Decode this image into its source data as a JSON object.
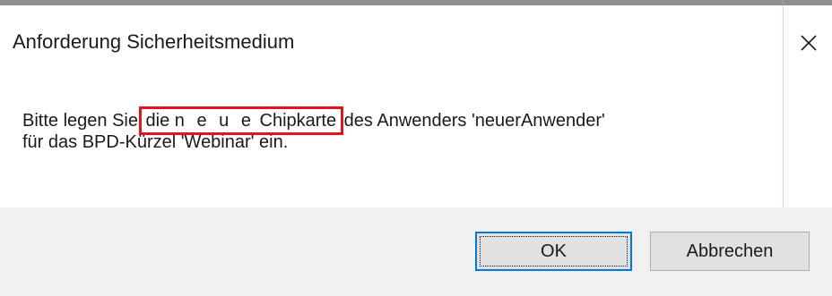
{
  "dialog": {
    "title": "Anforderung Sicherheitsmedium",
    "close_icon": "close-icon",
    "message": {
      "before": "Bitte legen Sie ",
      "highlight_1": "die ",
      "highlight_2": "n e u e",
      "highlight_3": " Chipkarte",
      "after_line_1": " des Anwenders 'neuerAnwender'",
      "line_2": "für das BPD-Kürzel 'Webinar' ein."
    },
    "highlight_color": "#e3141c",
    "buttons": {
      "ok_label": "OK",
      "cancel_label": "Abbrechen"
    },
    "focus_color": "#0078d7"
  }
}
